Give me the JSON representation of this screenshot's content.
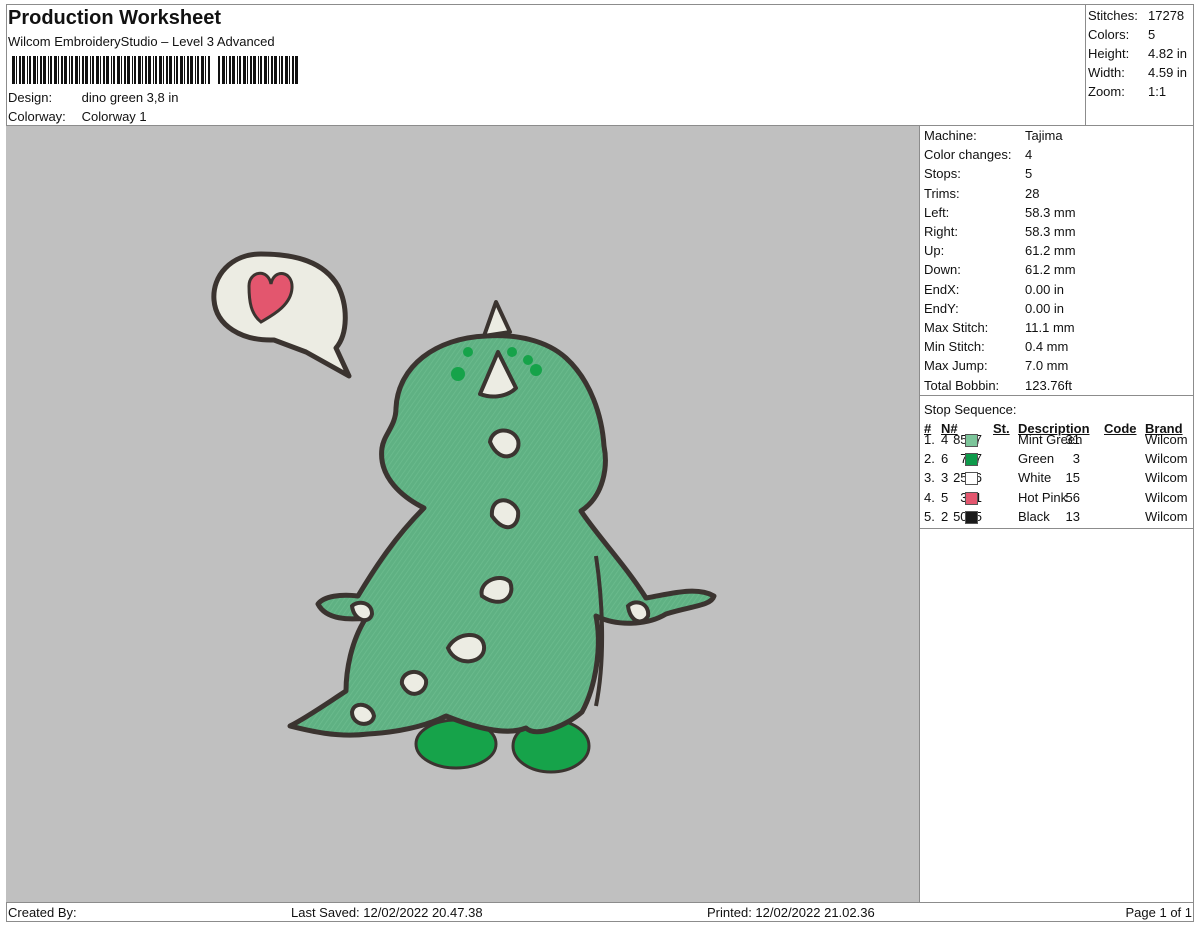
{
  "header": {
    "title": "Production Worksheet",
    "software": "Wilcom EmbroideryStudio – Level 3 Advanced",
    "design_label": "Design:",
    "design_value": "dino green 3,8 in",
    "colorway_label": "Colorway:",
    "colorway_value": "Colorway 1"
  },
  "stats": {
    "stitches_label": "Stitches:",
    "stitches_value": "17278",
    "colors_label": "Colors:",
    "colors_value": "5",
    "height_label": "Height:",
    "height_value": "4.82 in",
    "width_label": "Width:",
    "width_value": "4.59 in",
    "zoom_label": "Zoom:",
    "zoom_value": "1:1"
  },
  "machine": {
    "rows": [
      {
        "label": "Machine:",
        "value": "Tajima"
      },
      {
        "label": "Color changes:",
        "value": "4"
      },
      {
        "label": "Stops:",
        "value": "5"
      },
      {
        "label": "Trims:",
        "value": "28"
      },
      {
        "label": "Left:",
        "value": "58.3 mm"
      },
      {
        "label": "Right:",
        "value": "58.3 mm"
      },
      {
        "label": "Up:",
        "value": "61.2 mm"
      },
      {
        "label": "Down:",
        "value": "61.2 mm"
      },
      {
        "label": "EndX:",
        "value": "0.00 in"
      },
      {
        "label": "EndY:",
        "value": "0.00 in"
      },
      {
        "label": "Max Stitch:",
        "value": "11.1 mm"
      },
      {
        "label": "Min Stitch:",
        "value": "0.4 mm"
      },
      {
        "label": "Max Jump:",
        "value": "7.0 mm"
      },
      {
        "label": "Total Bobbin:",
        "value": "123.76ft"
      }
    ]
  },
  "stop_sequence": {
    "title": "Stop Sequence:",
    "columns": {
      "num": "#",
      "n": "N#",
      "st": "St.",
      "desc": "Description",
      "code": "Code",
      "brand": "Brand"
    },
    "rows": [
      {
        "num": "1.",
        "n": "4",
        "color": "#7cc59a",
        "st": "8597",
        "desc": "Mint Green",
        "code": "31",
        "brand": "Wilcom"
      },
      {
        "num": "2.",
        "n": "6",
        "color": "#0e9a4a",
        "st": "767",
        "desc": "Green",
        "code": "3",
        "brand": "Wilcom"
      },
      {
        "num": "3.",
        "n": "3",
        "color": "#ffffff",
        "st": "2506",
        "desc": "White",
        "code": "15",
        "brand": "Wilcom"
      },
      {
        "num": "4.",
        "n": "5",
        "color": "#e3566e",
        "st": "321",
        "desc": "Hot Pink",
        "code": "56",
        "brand": "Wilcom"
      },
      {
        "num": "5.",
        "n": "2",
        "color": "#1a1a1a",
        "st": "5085",
        "desc": "Black",
        "code": "13",
        "brand": "Wilcom"
      }
    ]
  },
  "footer": {
    "created_by": "Created By:",
    "last_saved": "Last Saved: 12/02/2022 20.47.38",
    "printed": "Printed: 12/02/2022 21.02.36",
    "page": "Page 1 of 1"
  },
  "colors": {
    "canvas_bg": "#c0c0c0",
    "dino_body": "#5fb183",
    "dino_light": "#7ecb9d",
    "dino_feet": "#16a34a",
    "outline": "#3b3430",
    "spots": "#ecece3",
    "heart": "#e3566e"
  }
}
